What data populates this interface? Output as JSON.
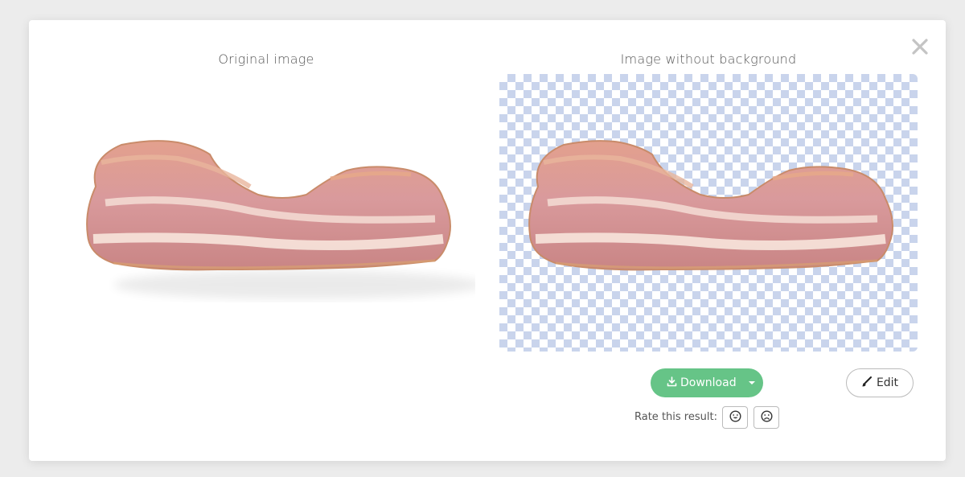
{
  "dialog": {
    "original_title": "Original image",
    "result_title": "Image without background",
    "close_icon": "close-icon"
  },
  "actions": {
    "download_label": "Download",
    "download_icon": "download-icon",
    "download_menu_icon": "caret-down-icon",
    "edit_label": "Edit",
    "edit_icon": "brush-icon"
  },
  "rating": {
    "label": "Rate this result:",
    "good_icon": "smile-icon",
    "bad_icon": "frown-icon"
  },
  "colors": {
    "accent": "#66c487",
    "checker": "#c9d4ec"
  }
}
